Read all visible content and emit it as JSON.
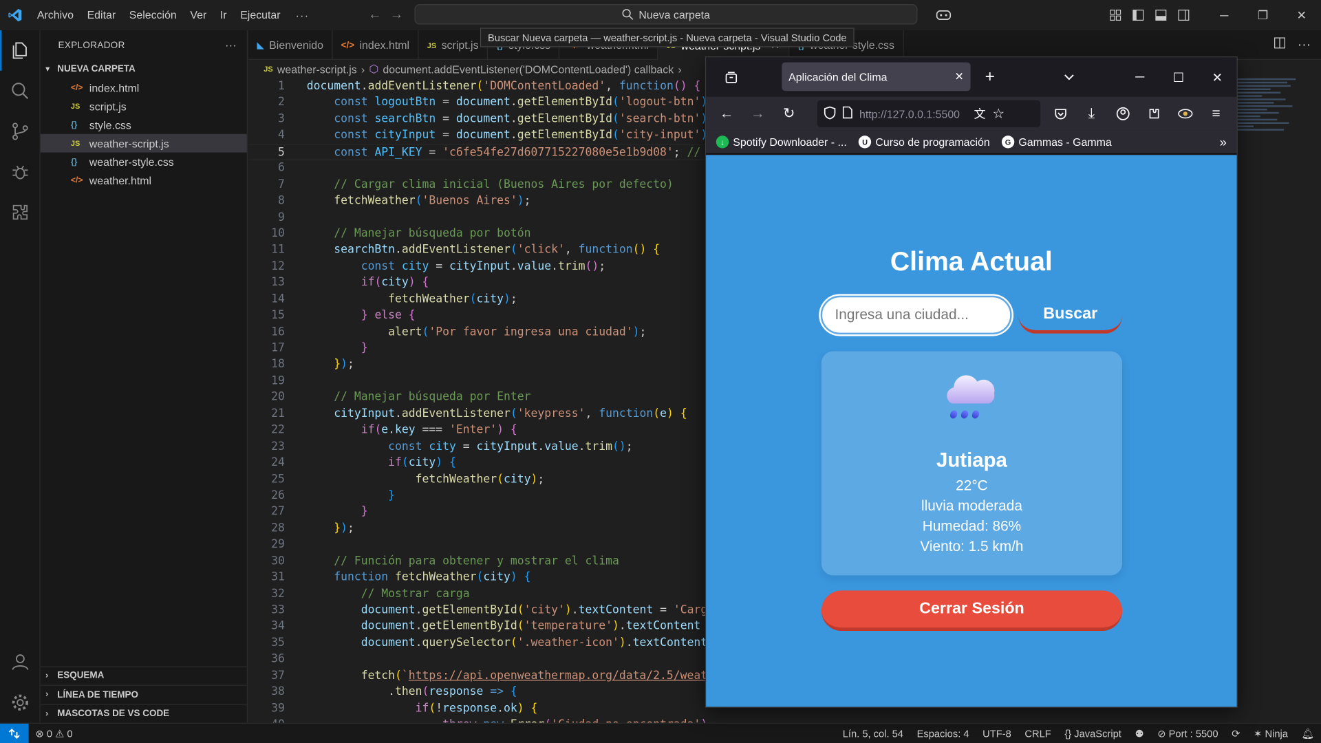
{
  "titlebar": {
    "menu": [
      "Archivo",
      "Editar",
      "Selección",
      "Ver",
      "Ir",
      "Ejecutar"
    ],
    "more": "···",
    "search": "Nueva carpeta",
    "tooltip": "Buscar Nueva carpeta — weather-script.js - Nueva carpeta - Visual Studio Code"
  },
  "sidebar": {
    "title": "EXPLORADOR",
    "more": "···",
    "folder": "NUEVA CARPETA",
    "files": [
      {
        "name": "index.html",
        "icon": "html"
      },
      {
        "name": "script.js",
        "icon": "js"
      },
      {
        "name": "style.css",
        "icon": "css"
      },
      {
        "name": "weather-script.js",
        "icon": "js"
      },
      {
        "name": "weather-style.css",
        "icon": "css"
      },
      {
        "name": "weather.html",
        "icon": "html"
      }
    ],
    "bottom_sections": [
      "ESQUEMA",
      "LÍNEA DE TIEMPO",
      "MASCOTAS DE VS CODE"
    ]
  },
  "tabs": [
    {
      "label": "Bienvenido"
    },
    {
      "label": "index.html"
    },
    {
      "label": "script.js"
    },
    {
      "label": "style.css"
    },
    {
      "label": "weather.html"
    },
    {
      "label": "weather-script.js"
    },
    {
      "label": "weather-style.css"
    }
  ],
  "breadcrumb": {
    "file": "weather-script.js",
    "symbol": "document.addEventListener('DOMContentLoaded') callback"
  },
  "statusbar": {
    "errors": "0",
    "warnings": "0",
    "position": "Lín. 5, col. 54",
    "spaces": "Espacios: 4",
    "encoding": "UTF-8",
    "eol": "CRLF",
    "language": "JavaScript",
    "port": "Port : 5500",
    "ninja": "Ninja"
  },
  "browser": {
    "tab_title": "Aplicación del Clima",
    "url_scheme": "http://",
    "url_host": "127.0.0.1:5500",
    "bookmarks": [
      "Spotify Downloader - ...",
      "Curso de programación",
      "Gammas - Gamma"
    ],
    "app": {
      "title": "Clima Actual",
      "placeholder": "Ingresa una ciudad...",
      "search_label": "Buscar",
      "city": "Jutiapa",
      "temperature": "22°C",
      "description": "lluvia moderada",
      "humidity": "Humedad: 86%",
      "wind": "Viento: 1.5 km/h",
      "logout_label": "Cerrar Sesión"
    }
  },
  "colors": {
    "accent": "#0078d4",
    "page_background": "#3a96dd",
    "logout": "#e74c3c"
  }
}
